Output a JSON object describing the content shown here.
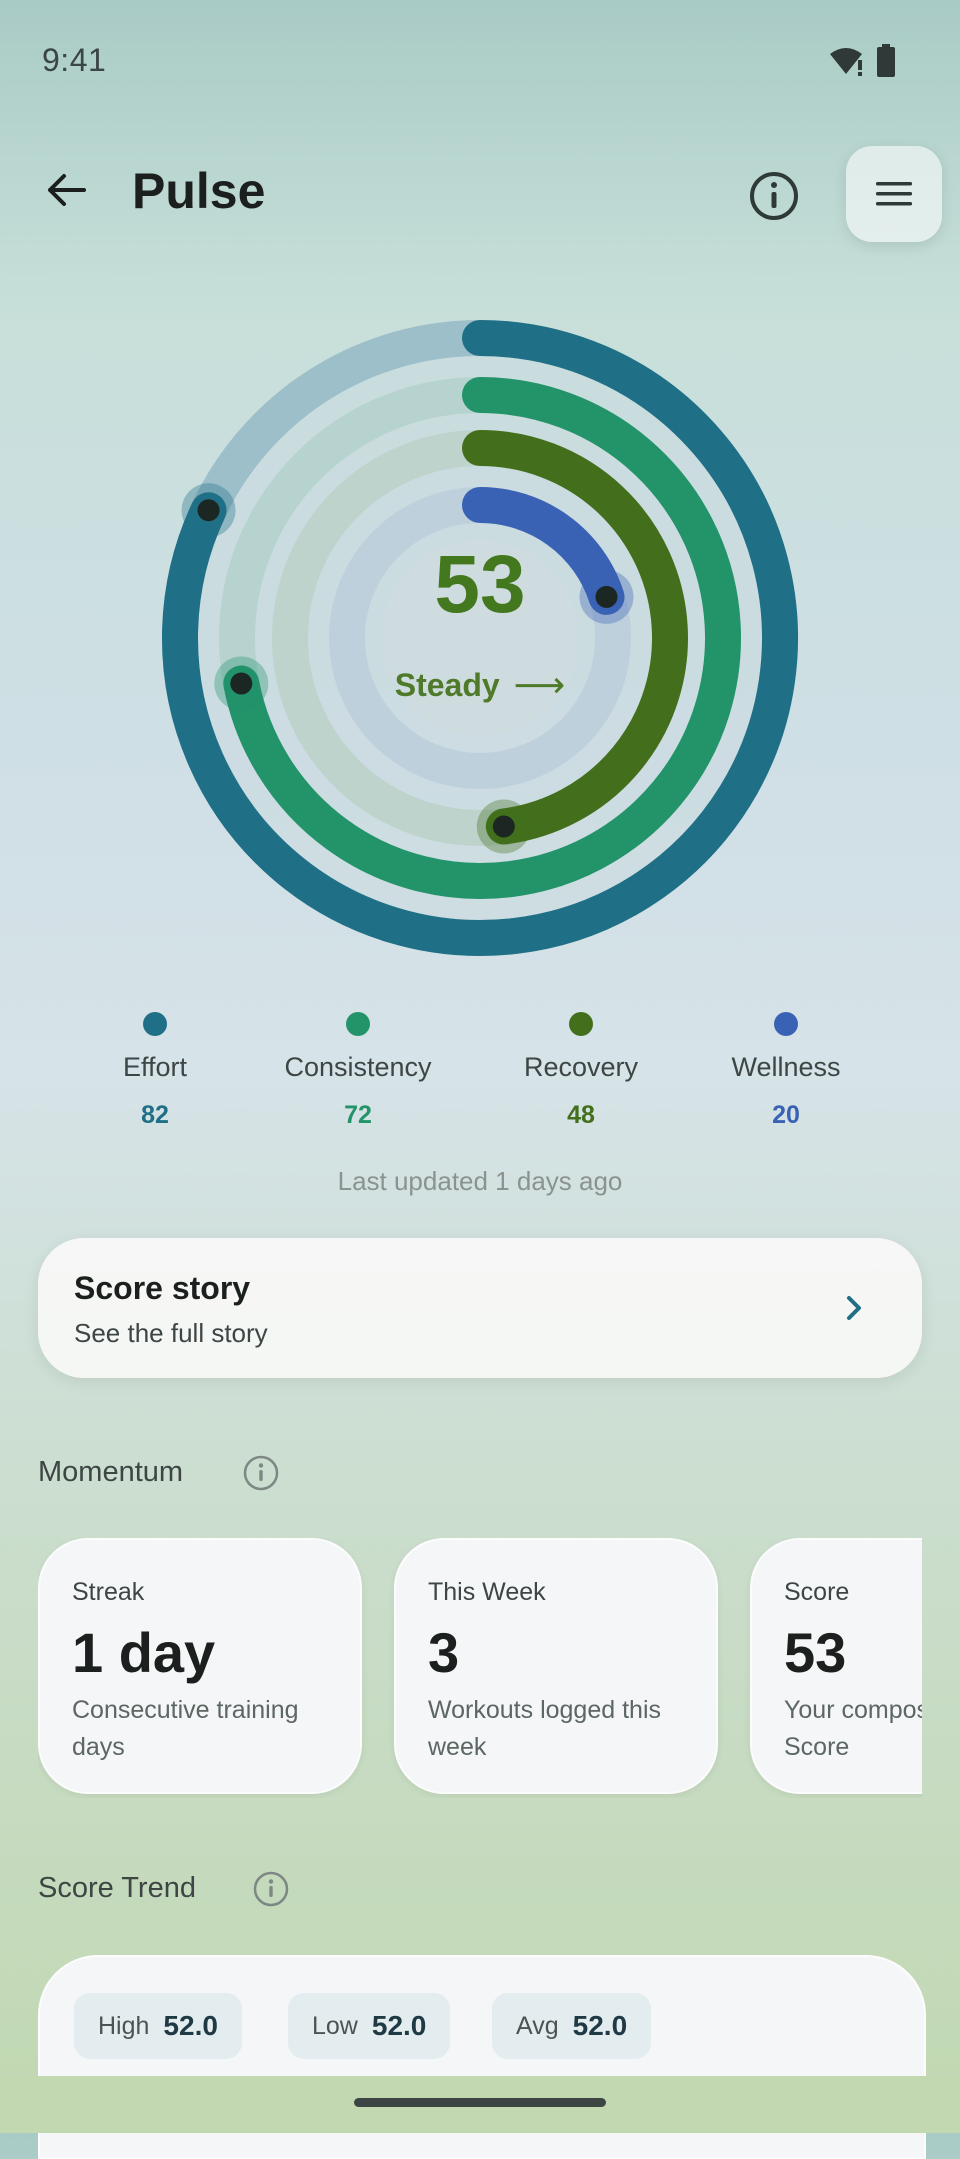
{
  "status_bar": {
    "time": "9:41"
  },
  "app_bar": {
    "title": "Pulse"
  },
  "score": {
    "value": "53",
    "status": "Steady",
    "arrow": "⟶"
  },
  "rings": [
    {
      "name": "Effort",
      "value": 82,
      "color": "#1f6f86",
      "track": "#9dbfca"
    },
    {
      "name": "Consistency",
      "value": 72,
      "color": "#23936a",
      "track": "#b6d3cf"
    },
    {
      "name": "Recovery",
      "value": 48,
      "color": "#436f1c",
      "track": "#bdd3cc"
    },
    {
      "name": "Wellness",
      "value": 20,
      "color": "#3a62b4",
      "track": "#bfd0dd"
    }
  ],
  "legend": [
    {
      "label": "Effort",
      "value": "82",
      "color": "#1f6f86"
    },
    {
      "label": "Consistency",
      "value": "72",
      "color": "#23936a"
    },
    {
      "label": "Recovery",
      "value": "48",
      "color": "#436f1c"
    },
    {
      "label": "Wellness",
      "value": "20",
      "color": "#3a62b4"
    }
  ],
  "last_updated": "Last updated 1 days ago",
  "story_card": {
    "title": "Score story",
    "subtitle": "See the full story"
  },
  "momentum": {
    "title": "Momentum",
    "cards": [
      {
        "label": "Streak",
        "big": "1 day",
        "desc": "Consecutive training days"
      },
      {
        "label": "This Week",
        "big": "3",
        "desc": "Workouts logged this week"
      },
      {
        "label": "Score",
        "big": "53",
        "desc": "Your composite Kinoku Score"
      }
    ]
  },
  "score_trend": {
    "title": "Score Trend",
    "chips": [
      {
        "key": "High",
        "value": "52.0"
      },
      {
        "key": "Low",
        "value": "52.0"
      },
      {
        "key": "Avg",
        "value": "52.0"
      }
    ]
  }
}
